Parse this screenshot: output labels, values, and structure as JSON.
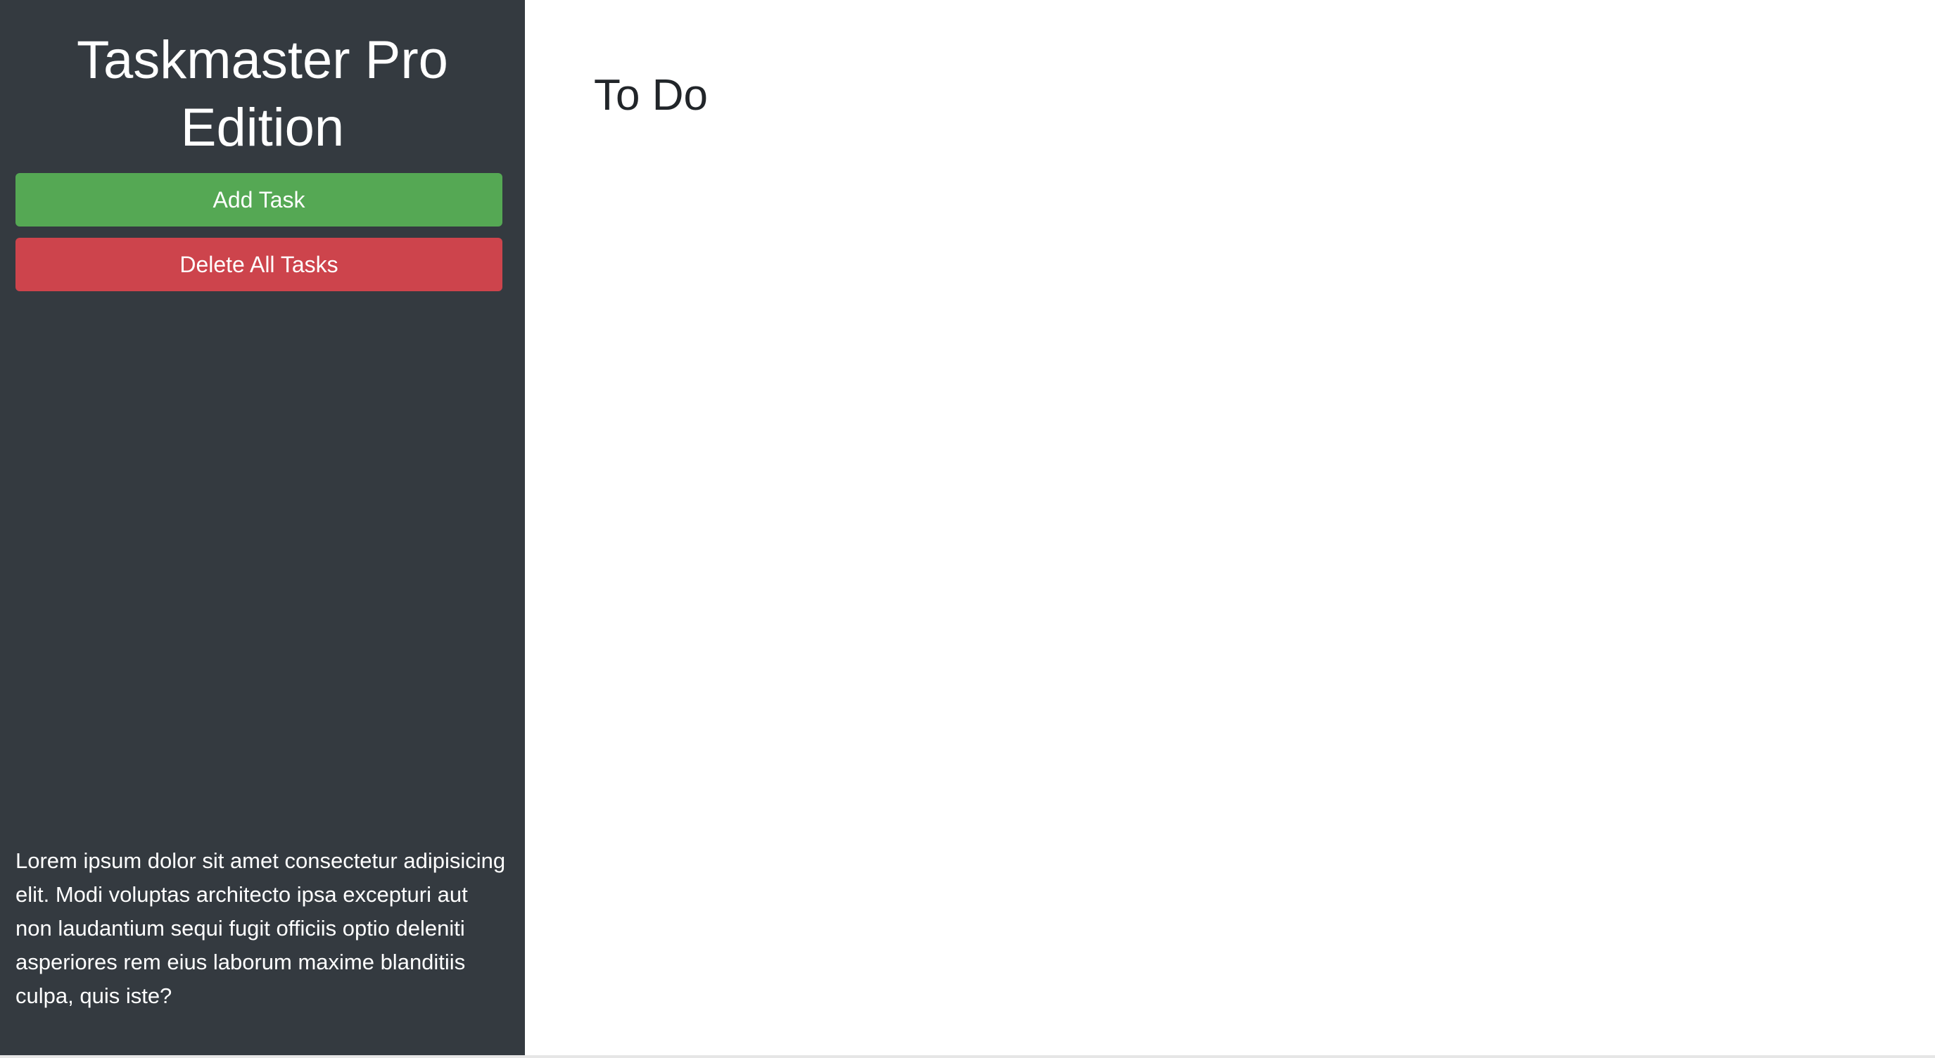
{
  "sidebar": {
    "title": "Taskmaster Pro Edition",
    "add_task_label": "Add Task",
    "delete_all_label": "Delete All Tasks",
    "footer_text": "Lorem ipsum dolor sit amet consectetur adipisicing elit. Modi voluptas architecto ipsa excepturi aut non laudantium sequi fugit officiis optio deleniti asperiores rem eius laborum maxime blanditiis culpa, quis iste?"
  },
  "main": {
    "section_title": "To Do",
    "tasks": []
  },
  "colors": {
    "sidebar_bg": "#343a40",
    "add_button": "#55a854",
    "delete_button": "#cd444c",
    "main_bg": "#ffffff",
    "heading_text": "#212529"
  }
}
